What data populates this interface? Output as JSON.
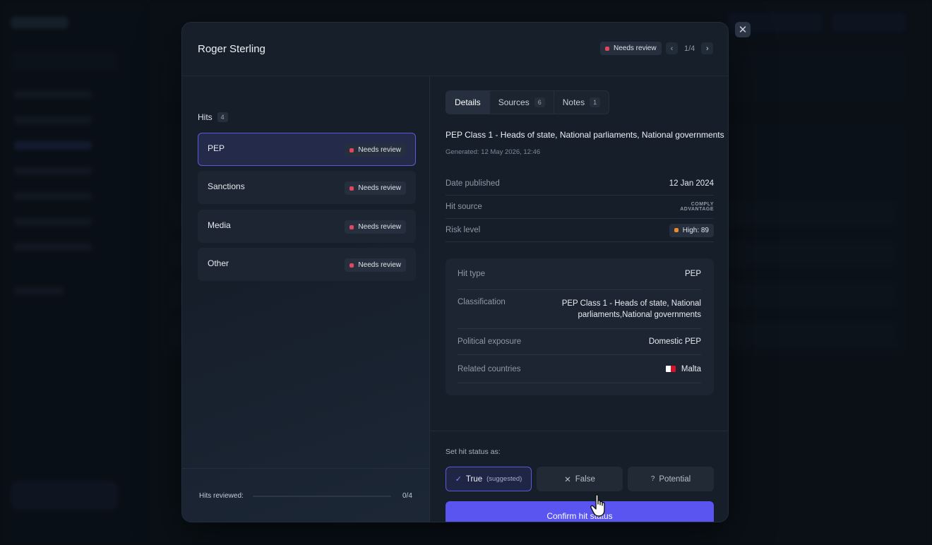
{
  "modal": {
    "title": "Roger Sterling",
    "status_badge": "Needs review",
    "pager": "1/4",
    "close_icon": "close-icon"
  },
  "hits": {
    "title": "Hits",
    "count": "4",
    "items": [
      {
        "label": "PEP",
        "badge": "Needs review"
      },
      {
        "label": "Sanctions",
        "badge": "Needs review"
      },
      {
        "label": "Media",
        "badge": "Needs review"
      },
      {
        "label": "Other",
        "badge": "Needs review"
      }
    ],
    "reviewed_label": "Hits reviewed:",
    "reviewed_count": "0/4",
    "reviewed_fraction": 0
  },
  "tabs": [
    {
      "label": "Details",
      "count": ""
    },
    {
      "label": "Sources",
      "count": "6"
    },
    {
      "label": "Notes",
      "count": "1"
    }
  ],
  "details": {
    "title": "PEP Class 1 - Heads of state, National parliaments, National governments",
    "generated": "Generated: 12 May 2026, 12:46",
    "rows": [
      {
        "key": "Date published",
        "value": "12 Jan 2024"
      },
      {
        "key": "Hit source",
        "value": "COMPLY ADVANTAGE"
      },
      {
        "key": "Risk level",
        "value": "High: 89"
      }
    ],
    "source_logo_line1": "COMPLY",
    "source_logo_line2": "ADVANTAGE",
    "sub": {
      "hit_type_key": "Hit type",
      "hit_type_val": "PEP",
      "classification_key": "Classification",
      "classification_val_1": "PEP Class 1 - Heads of state, National",
      "classification_val_2": "parliaments,National governments",
      "exposure_key": "Political exposure",
      "exposure_val": "Domestic PEP",
      "countries_key": "Related countries",
      "countries_val": "Malta"
    }
  },
  "status": {
    "label": "Set hit status as:",
    "true_label": "True",
    "true_suggested": "(suggested)",
    "false_label": "False",
    "potential_label": "Potential",
    "confirm_label": "Confirm hit status"
  },
  "colors": {
    "accent": "#5a55f0",
    "badge_dot": "#e0465f",
    "risk_dot": "#f08a24"
  }
}
